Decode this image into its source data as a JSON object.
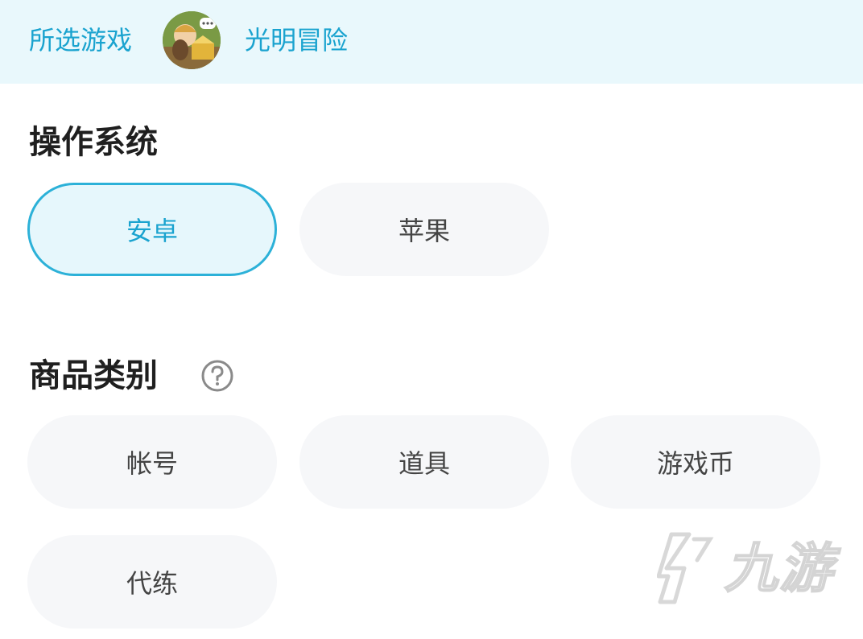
{
  "header": {
    "label": "所选游戏",
    "game_name": "光明冒险",
    "avatar_icon": "game-avatar-icon"
  },
  "os_section": {
    "title": "操作系统",
    "options": [
      "安卓",
      "苹果"
    ],
    "selected": "安卓"
  },
  "category_section": {
    "title": "商品类别",
    "help_icon": "question-circle-icon",
    "options": [
      "帐号",
      "道具",
      "游戏币",
      "代练"
    ]
  },
  "watermark": {
    "text": "九游",
    "icon": "jiuyou-logo-icon"
  },
  "colors": {
    "accent": "#1aa3cf",
    "accent_border": "#2cb1d8",
    "header_bg": "#e9f8fc",
    "pill_bg": "#f6f7f9",
    "selected_bg": "#e6f7fc"
  }
}
